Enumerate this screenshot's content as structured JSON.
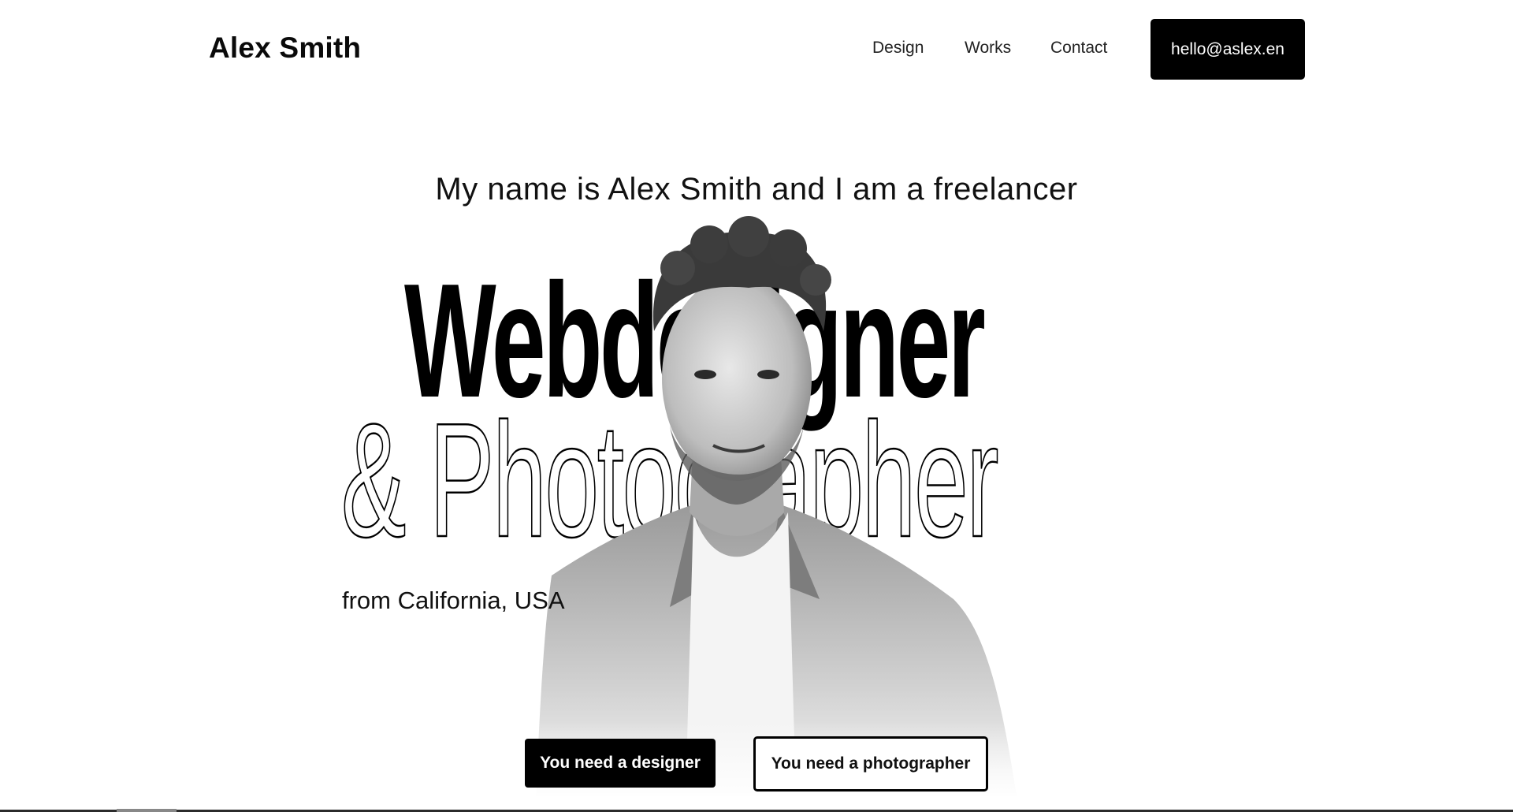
{
  "header": {
    "logo": "Alex Smith",
    "nav": [
      "Design",
      "Works",
      "Contact"
    ],
    "email_button": "hello@aslex.en"
  },
  "hero": {
    "intro": "My name is Alex Smith and I am a freelancer",
    "title_line1": "Webdesigner",
    "title_line2": "& Photographer",
    "location": "from California, USA",
    "buttons": {
      "designer": "You need a designer",
      "photographer": "You need a photographer"
    }
  },
  "colors": {
    "background": "#ffffff",
    "primary": "#000000",
    "text": "#111111"
  }
}
